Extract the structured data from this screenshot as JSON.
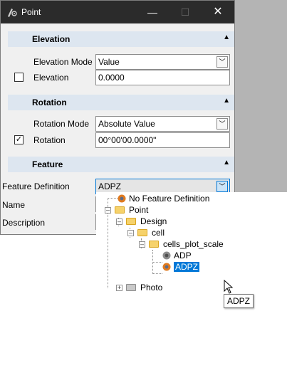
{
  "window": {
    "title": "Point",
    "icons": {
      "app": "point-tool-icon",
      "minimize": "minimize-icon",
      "maximize": "maximize-icon",
      "close": "close-icon"
    }
  },
  "elevation": {
    "header": "Elevation",
    "mode_label": "Elevation Mode",
    "mode_value": "Value",
    "field_label": "Elevation",
    "field_checked": false,
    "field_value": "0.0000"
  },
  "rotation": {
    "header": "Rotation",
    "mode_label": "Rotation Mode",
    "mode_value": "Absolute Value",
    "field_label": "Rotation",
    "field_checked": true,
    "field_value": "00°00'00.0000\""
  },
  "feature": {
    "header": "Feature",
    "definition_label": "Feature Definition",
    "definition_value": "ADPZ",
    "name_label": "Name",
    "description_label": "Description"
  },
  "tree": {
    "items": [
      {
        "label": "No Feature Definition",
        "icon": "feature-icon"
      },
      {
        "label": "Point",
        "icon": "folder-icon"
      },
      {
        "label": "Design",
        "icon": "folder-icon"
      },
      {
        "label": "cell",
        "icon": "folder-icon"
      },
      {
        "label": "cells_plot_scale",
        "icon": "folder-icon"
      },
      {
        "label": "ADP",
        "icon": "feature-icon"
      },
      {
        "label": "ADPZ",
        "icon": "feature-icon",
        "selected": true
      },
      {
        "label": "Photo",
        "icon": "folder-icon"
      }
    ]
  },
  "tooltip": "ADPZ",
  "colors": {
    "titlebar": "#2b2b2b",
    "section_header": "#dde6f0",
    "selection": "#0078d7"
  }
}
